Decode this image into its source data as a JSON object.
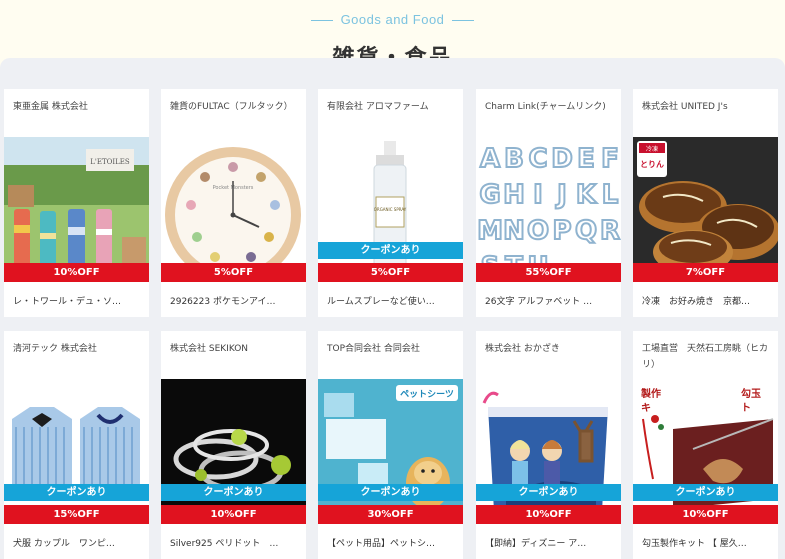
{
  "section": {
    "subtitle": "Goods and Food",
    "title": "雑貨・食品"
  },
  "coupon_label": "クーポンあり",
  "products": [
    {
      "company": "東亜金属 株式会社",
      "discount": "10%OFF",
      "name": "レ・トワール・デュ・ソ…",
      "coupon": false
    },
    {
      "company": "雑貨のFULTAC（フルタック）",
      "discount": "5%OFF",
      "name": "2926223 ポケモンアイ…",
      "coupon": false
    },
    {
      "company": "有限会社 アロマファーム",
      "discount": "5%OFF",
      "name": "ルームスプレーなど使い…",
      "coupon": true
    },
    {
      "company": "Charm Link(チャームリンク)",
      "discount": "55%OFF",
      "name": "26文字 アルファベット …",
      "coupon": false
    },
    {
      "company": "株式会社 UNITED J's",
      "discount": "7%OFF",
      "name": "冷凍　お好み焼き　京都…",
      "coupon": false
    },
    {
      "company": "清河テック 株式会社",
      "discount": "15%OFF",
      "name": "犬服 カップル　ワンピ…",
      "coupon": true
    },
    {
      "company": "株式会社 SEKIKON",
      "discount": "10%OFF",
      "name": "Silver925 ペリドット　…",
      "coupon": true
    },
    {
      "company": "TOP合同会社 合同会社",
      "discount": "30%OFF",
      "name": "【ペット用品】ペットシ…",
      "coupon": true
    },
    {
      "company": "株式会社 おかざき",
      "discount": "10%OFF",
      "name": "【即納】ディズニー ア…",
      "coupon": true
    },
    {
      "company": "工場直営　天然石工房眺（ヒカリ）",
      "discount": "10%OFF",
      "name": "勾玉製作キット 【 屋久…",
      "coupon": true
    }
  ],
  "image_texts": {
    "tumbler_sign": "L'ETOILES",
    "clock_brand": "Pocket Monsters",
    "spray_label": "ORGANIC SPRAY",
    "letters": [
      "A",
      "B",
      "C",
      "D",
      "E",
      "F",
      "G",
      "H",
      "I",
      "J",
      "K",
      "L",
      "M",
      "N",
      "O",
      "P",
      "Q",
      "R",
      "S",
      "T",
      "U"
    ],
    "okonomi_badge": "冷凍",
    "okonomi_sub": "とりん",
    "petsheet_banner": "ペットシーツ",
    "magatama_labels": [
      "製作",
      "勾玉",
      "キ",
      "ト"
    ]
  },
  "colors": {
    "accent_blue": "#16a4d8",
    "discount_red": "#e0121f",
    "subtitle_blue": "#7cc3e0"
  }
}
